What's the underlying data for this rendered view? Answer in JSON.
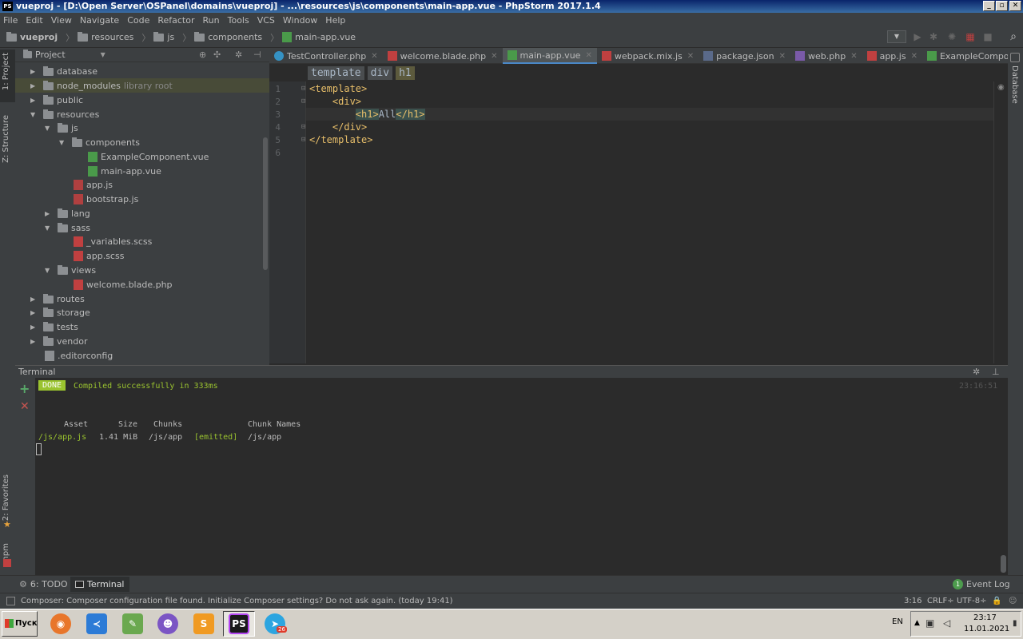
{
  "window": {
    "app_icon": "PS",
    "title": "vueproj - [D:\\Open Server\\OSPanel\\domains\\vueproj] - ...\\resources\\js\\components\\main-app.vue - PhpStorm 2017.1.4",
    "minimize": "_",
    "maximize": "▫",
    "close": "✕"
  },
  "menu": [
    "File",
    "Edit",
    "View",
    "Navigate",
    "Code",
    "Refactor",
    "Run",
    "Tools",
    "VCS",
    "Window",
    "Help"
  ],
  "breadcrumb": [
    "vueproj",
    "resources",
    "js",
    "components",
    "main-app.vue"
  ],
  "left_strip": {
    "project": "1: Project",
    "structure": "Z: Structure",
    "favorites": "2: Favorites",
    "npm": "npm"
  },
  "project_panel": {
    "title": "Project"
  },
  "tree": [
    {
      "label": "database",
      "extra": ""
    },
    {
      "label": "node_modules",
      "extra": "library root"
    },
    {
      "label": "public",
      "extra": ""
    },
    {
      "label": "resources",
      "extra": ""
    },
    {
      "label": "js",
      "extra": ""
    },
    {
      "label": "components",
      "extra": ""
    },
    {
      "label": "ExampleComponent.vue",
      "extra": ""
    },
    {
      "label": "main-app.vue",
      "extra": ""
    },
    {
      "label": "app.js",
      "extra": ""
    },
    {
      "label": "bootstrap.js",
      "extra": ""
    },
    {
      "label": "lang",
      "extra": ""
    },
    {
      "label": "sass",
      "extra": ""
    },
    {
      "label": "_variables.scss",
      "extra": ""
    },
    {
      "label": "app.scss",
      "extra": ""
    },
    {
      "label": "views",
      "extra": ""
    },
    {
      "label": "welcome.blade.php",
      "extra": ""
    },
    {
      "label": "routes",
      "extra": ""
    },
    {
      "label": "storage",
      "extra": ""
    },
    {
      "label": "tests",
      "extra": ""
    },
    {
      "label": "vendor",
      "extra": ""
    },
    {
      "label": ".editorconfig",
      "extra": ""
    }
  ],
  "tabs": [
    {
      "label": "TestController.php",
      "icon": "php-class-icon",
      "color": "#3592c4"
    },
    {
      "label": "welcome.blade.php",
      "icon": "blade-file-icon",
      "color": "#c04040"
    },
    {
      "label": "main-app.vue",
      "icon": "vue-file-icon",
      "color": "#4a9a4a"
    },
    {
      "label": "webpack.mix.js",
      "icon": "js-file-icon",
      "color": "#c04040"
    },
    {
      "label": "package.json",
      "icon": "json-file-icon",
      "color": "#5a6a8a"
    },
    {
      "label": "web.php",
      "icon": "php-file-icon",
      "color": "#7a5aa8"
    },
    {
      "label": "app.js",
      "icon": "js-file-icon",
      "color": "#c04040"
    },
    {
      "label": "ExampleComponent.vue",
      "icon": "vue-file-icon",
      "color": "#4a9a4a"
    }
  ],
  "editor_breadcrumb": [
    "template",
    "div",
    "h1"
  ],
  "code": {
    "line_numbers": [
      "1",
      "2",
      "3",
      "4",
      "5",
      "6"
    ],
    "lines": [
      "<template>",
      "    <div>",
      "        <h1>All</h1>",
      "    </div>",
      "</template>",
      ""
    ],
    "line3": {
      "indent": "        ",
      "open": "<h1>",
      "text": "All",
      "close": "</h1>"
    }
  },
  "db_strip": "Database",
  "terminal": {
    "title": "Terminal",
    "done_badge": "DONE",
    "message": "Compiled successfully in 333ms",
    "time": "23:16:51",
    "headers": [
      "Asset",
      "Size",
      "Chunks",
      "Chunk Names"
    ],
    "row": {
      "asset": "/js/app.js",
      "size": "1.41 MiB",
      "chunks": "/js/app",
      "flag": "[emitted]",
      "name": "/js/app"
    }
  },
  "bottom_tabs": {
    "todo": "6: TODO",
    "terminal": "Terminal",
    "event_log": "Event Log",
    "event_count": "1"
  },
  "status": {
    "message": "Composer: Composer configuration file found. Initialize Composer settings? Do not ask again. (today 19:41)",
    "position": "3:16",
    "line_sep": "CRLF",
    "encoding": "UTF-8"
  },
  "taskbar": {
    "start": "Пуск",
    "apps": [
      {
        "name": "firefox",
        "glyph": "◉",
        "color": "#e8762b"
      },
      {
        "name": "vscode",
        "glyph": "≺",
        "color": "#2c7bd6"
      },
      {
        "name": "notepad",
        "glyph": "✎",
        "color": "#6aa84f"
      },
      {
        "name": "github-desktop",
        "glyph": "☻",
        "color": "#7b55c4"
      },
      {
        "name": "sublime",
        "glyph": "S",
        "color": "#f09a22"
      },
      {
        "name": "phpstorm",
        "glyph": "PS",
        "color": "#1a1a1a"
      },
      {
        "name": "telegram",
        "glyph": "➤",
        "color": "#2ca5e0"
      }
    ],
    "telegram_badge": "26",
    "lang": "EN",
    "clock_time": "23:17",
    "clock_date": "11.01.2021"
  },
  "colors": {
    "accent": "#4a88c7",
    "done_bg": "#9ac32f",
    "tag": "#e8bf6a",
    "text": "#a9b7c6"
  }
}
